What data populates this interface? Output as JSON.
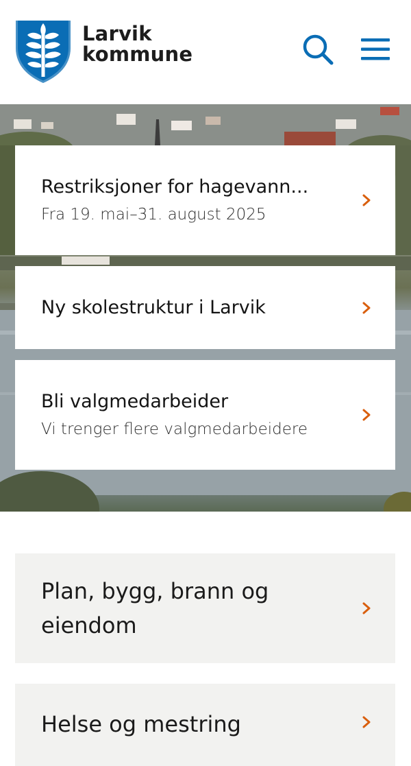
{
  "header": {
    "logo_line1": "Larvik",
    "logo_line2": "kommune",
    "search_icon": "search-icon",
    "menu_icon": "hamburger-menu-icon"
  },
  "hero": {
    "cards": [
      {
        "title": "Restriksjoner for hagevann...",
        "subtitle": "Fra 19. mai–31. august 2025"
      },
      {
        "title": "Ny skolestruktur i Larvik",
        "subtitle": ""
      },
      {
        "title": "Bli valgmedarbeider",
        "subtitle": "Vi trenger flere valgmedarbeidere"
      }
    ]
  },
  "categories": [
    {
      "label": "Plan, bygg, brann og eiendom"
    },
    {
      "label": "Helse og mestring"
    }
  ],
  "colors": {
    "brand_blue": "#0a6db5",
    "accent_orange": "#d95f0e",
    "tile_background": "#f2f2f0"
  }
}
